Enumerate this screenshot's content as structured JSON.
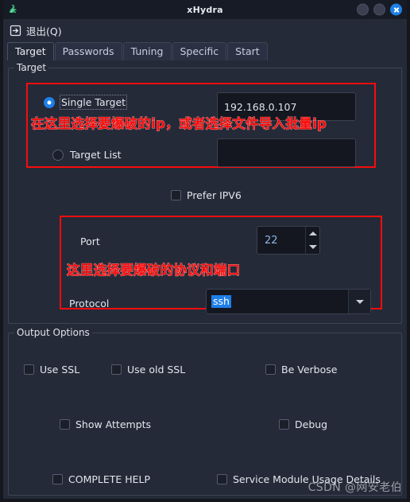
{
  "window": {
    "title": "xHydra",
    "app_icon": "hydra-icon",
    "buttons": [
      {
        "name": "minimize-button",
        "label": ""
      },
      {
        "name": "maximize-button",
        "label": ""
      },
      {
        "name": "close-button",
        "label": ""
      }
    ]
  },
  "menubar": {
    "quit_label": "退出(Q)",
    "quit_icon": "exit-icon"
  },
  "tabs": [
    {
      "label": "Target",
      "active": true
    },
    {
      "label": "Passwords",
      "active": false
    },
    {
      "label": "Tuning",
      "active": false
    },
    {
      "label": "Specific",
      "active": false
    },
    {
      "label": "Start",
      "active": false
    }
  ],
  "target_group": {
    "title": "Target",
    "single_target": {
      "label": "Single Target",
      "checked": true,
      "value": "192.168.0.107"
    },
    "target_list": {
      "label": "Target List",
      "checked": false,
      "value": ""
    },
    "prefer_ipv6": {
      "label": "Prefer IPV6",
      "checked": false
    },
    "port": {
      "label": "Port",
      "value": "22"
    },
    "protocol": {
      "label": "Protocol",
      "value": "ssh",
      "selected": true
    }
  },
  "output_group": {
    "title": "Output Options",
    "checkboxes": [
      {
        "label": "Use SSL",
        "checked": false
      },
      {
        "label": "Use old SSL",
        "checked": false
      },
      {
        "label": "Be Verbose",
        "checked": false
      },
      {
        "label": "Show Attempts",
        "checked": false
      },
      {
        "label": "Debug",
        "checked": false
      },
      {
        "label": "COMPLETE HELP",
        "checked": false
      },
      {
        "label": "Service Module Usage Details",
        "checked": false
      }
    ]
  },
  "annotations": [
    {
      "text": "在这里选择要爆破的ip，或者选择文件导入批量ip",
      "color": "#f50d0d"
    },
    {
      "text": "这里选择要爆破的协议和端口",
      "color": "#f50d0d"
    }
  ],
  "watermark": "CSDN @网安老伯"
}
